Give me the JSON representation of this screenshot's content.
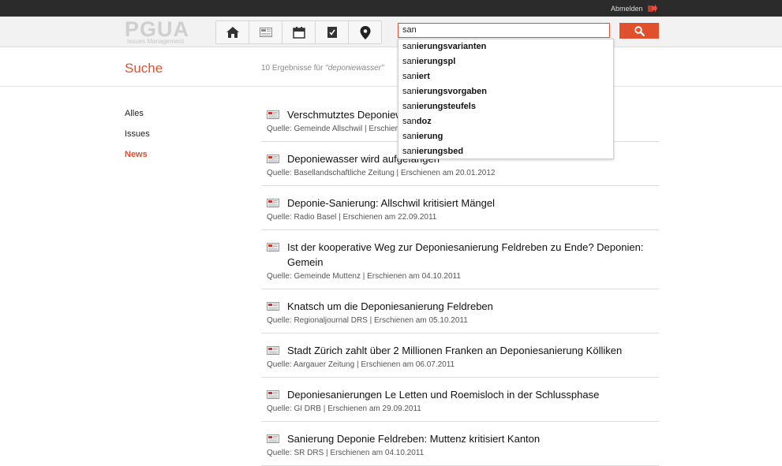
{
  "topbar": {
    "logout_label": "Abmelden"
  },
  "logo": {
    "main": "PGUA",
    "sub": "Issues Management"
  },
  "search": {
    "value": "san",
    "suggestions": [
      {
        "prefix": "san",
        "rest": "ierungsvarianten"
      },
      {
        "prefix": "san",
        "rest": "ierungspl"
      },
      {
        "prefix": "san",
        "rest": "iert"
      },
      {
        "prefix": "san",
        "rest": "ierungsvorgaben"
      },
      {
        "prefix": "san",
        "rest": "ierungsteufels"
      },
      {
        "prefix": "san",
        "rest": "doz"
      },
      {
        "prefix": "san",
        "rest": "ierung"
      },
      {
        "prefix": "san",
        "rest": "ierungsbed"
      }
    ]
  },
  "page": {
    "title": "Suche",
    "count_prefix": "10 Ergebnisse für ",
    "count_query": "\"deponiewasser\""
  },
  "filters": [
    {
      "label": "Alles",
      "active": false
    },
    {
      "label": "Issues",
      "active": false
    },
    {
      "label": "News",
      "active": true
    }
  ],
  "results": [
    {
      "title": "Verschmutztes Deponiewasser",
      "meta": "Quelle: Gemeinde Allschwil | Erschienen am 20.01.2012"
    },
    {
      "title": "Deponiewasser wird aufgefangen",
      "meta": "Quelle: Basellandschaftliche Zeitung | Erschienen am 20.01.2012"
    },
    {
      "title": "Deponie-Sanierung: Allschwil kritisiert Mängel",
      "meta": "Quelle: Radio Basel | Erschienen am 22.09.2011"
    },
    {
      "title": "Ist der kooperative Weg zur Deponiesanierung Feldreben zu Ende? Deponien: Gemein",
      "meta": "Quelle: Gemeinde Muttenz | Erschienen am 04.10.2011"
    },
    {
      "title": "Knatsch um die Deponiesanierung Feldreben",
      "meta": "Quelle: Regionaljournal DRS | Erschienen am 05.10.2011"
    },
    {
      "title": "Stadt Zürich zahlt über 2 Millionen Franken an Deponiesanierung Kölliken",
      "meta": "Quelle: Aargauer Zeitung | Erschienen am 06.07.2011"
    },
    {
      "title": "Deponiesanierungen Le Letten und Roemisloch in der Schlussphase",
      "meta": "Quelle: GI DRB | Erschienen am 29.09.2011"
    },
    {
      "title": "Sanierung Deponie Feldreben: Muttenz kritisiert Kanton",
      "meta": "Quelle: SR DRS | Erschienen am 04.10.2011"
    }
  ],
  "colors": {
    "accent": "#e0502c",
    "topbar": "#2b2b2b"
  }
}
